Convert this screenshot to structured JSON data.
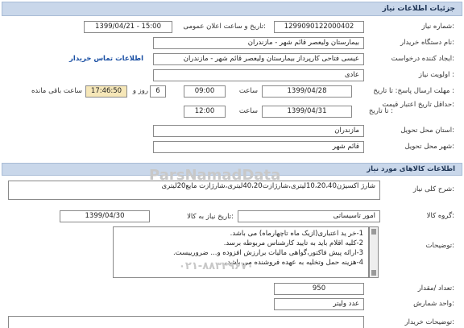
{
  "header": {
    "title": "جزئیات اطلاعات نیاز"
  },
  "fields": {
    "need_number_label": "شماره نیاز:",
    "need_number": "1299090122000402",
    "announce_label": "تاریخ و ساعت اعلان عمومی:",
    "announce_value": "1399/04/21 - 15:00",
    "buyer_label": "نام دستگاه خریدار:",
    "buyer_value": "بیمارستان ولیعصر قائم شهر - مازندران",
    "creator_label": "ایجاد کننده درخواست:",
    "creator_value": "عیسی فتاحی کارپرداز بیمارستان ولیعصر قائم شهر - مازندران",
    "contact_link": "اطلاعات تماس خریدار",
    "priority_label": "اولویت نیاز :",
    "priority_value": "عادی",
    "deadline_label": "مهلت ارسال پاسخ: تا تاریخ :",
    "deadline_date": "1399/04/28",
    "time_label": "ساعت",
    "deadline_time": "09:00",
    "days_value": "6",
    "days_label": "روز و",
    "remaining_time": "17:46:50",
    "remaining_label": "ساعت باقی مانده",
    "validity_label": "حداقل تاریخ اعتبار قیمت:",
    "validity_prefix": "تا تاریخ :",
    "validity_date": "1399/04/31",
    "validity_time_label": "ساعت",
    "validity_time": "12:00",
    "province_label": "استان محل تحویل:",
    "province_value": "مازندران",
    "city_label": "شهر محل تحویل:",
    "city_value": "قائم شهر"
  },
  "goods": {
    "section_title": "اطلاعات کالاهای مورد نیاز",
    "summary_label": "شرح کلی نیاز:",
    "summary_value": "شارژ اکسیژن10،20،40لیتری،شارژازت40،20لیتری،شارژازت مایع20لیتری",
    "group_label": "گروه کالا:",
    "group_value": "امور تاسیساتی",
    "need_date_label": "تاریخ نیاز به کالا:",
    "need_date": "1399/04/30",
    "notes_label": "توضیحات:",
    "notes": [
      "1-خر ید اعتباری(ازیک ماه تاچهارماه) می باشد.",
      "2-کلیه اقلام باید به تایید کارشناس مربوطه برسد.",
      "3-ارائه پیش فاکتور،گواهی مالیات برارزش افزوده و... ضرورییست.",
      "4-هزینه حمل وتخلیه به عهده فروشنده می باشد."
    ],
    "watermark": "ParsNamadData",
    "watermark_phone": "۰۲۱-۸۸۳۴۹۶۷۰",
    "count_label": "تعداد /مقدار:",
    "count_value": "950",
    "unit_label": "واحد شمارش:",
    "unit_value": "عدد ولیتر",
    "buyer_notes_label": "توضیحات خریدار:"
  },
  "colors": {
    "header_bg": "#c9d7ea",
    "remaining_bg": "#f6e7b8",
    "link": "#1a4fa3"
  }
}
